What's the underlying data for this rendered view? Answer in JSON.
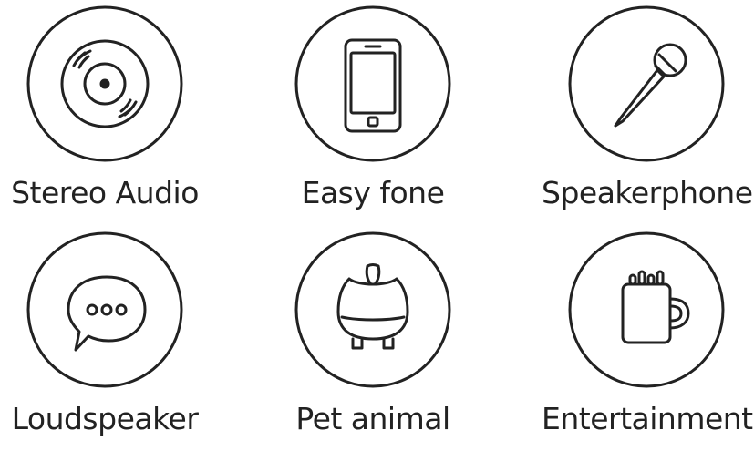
{
  "features": [
    {
      "label": "Stereo Audio",
      "icon": "vinyl-record-icon"
    },
    {
      "label": "Easy fone",
      "icon": "smartphone-icon"
    },
    {
      "label": "Speakerphone",
      "icon": "microphone-icon"
    },
    {
      "label": "Loudspeaker",
      "icon": "speech-bubble-icon"
    },
    {
      "label": "Pet animal",
      "icon": "pet-speaker-icon"
    },
    {
      "label": "Entertainment",
      "icon": "coffee-mug-icon"
    }
  ],
  "colors": {
    "stroke": "#222222",
    "background": "#ffffff"
  }
}
